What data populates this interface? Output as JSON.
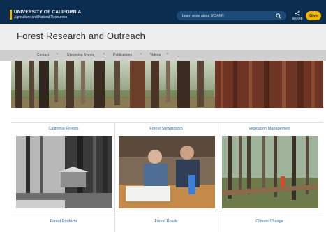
{
  "header": {
    "logo_line1": "UNIVERSITY OF CALIFORNIA",
    "logo_line2": "Agriculture and Natural Resources",
    "search_placeholder": "Learn more about UC ANR",
    "share_label": "SHARE",
    "give_label": "Give"
  },
  "page": {
    "title": "Forest Research and Outreach"
  },
  "nav": {
    "items": [
      {
        "label": "Contact"
      },
      {
        "label": "Upcoming Events"
      },
      {
        "label": "Publications"
      },
      {
        "label": "Videos"
      }
    ]
  },
  "cards": [
    {
      "title": "California Forests"
    },
    {
      "title": "Forest Stewardship"
    },
    {
      "title": "Vegetation Management"
    },
    {
      "title": "Forest Products"
    },
    {
      "title": "Forest Roads"
    },
    {
      "title": "Climate Change"
    }
  ],
  "colors": {
    "header_bg": "#0b2d4f",
    "accent": "#f5b400",
    "link": "#2f6fad",
    "title_band": "#eeeeee",
    "nav_band": "#cfcfcf"
  },
  "icons": {
    "search": "search-icon",
    "share": "share-icon"
  }
}
